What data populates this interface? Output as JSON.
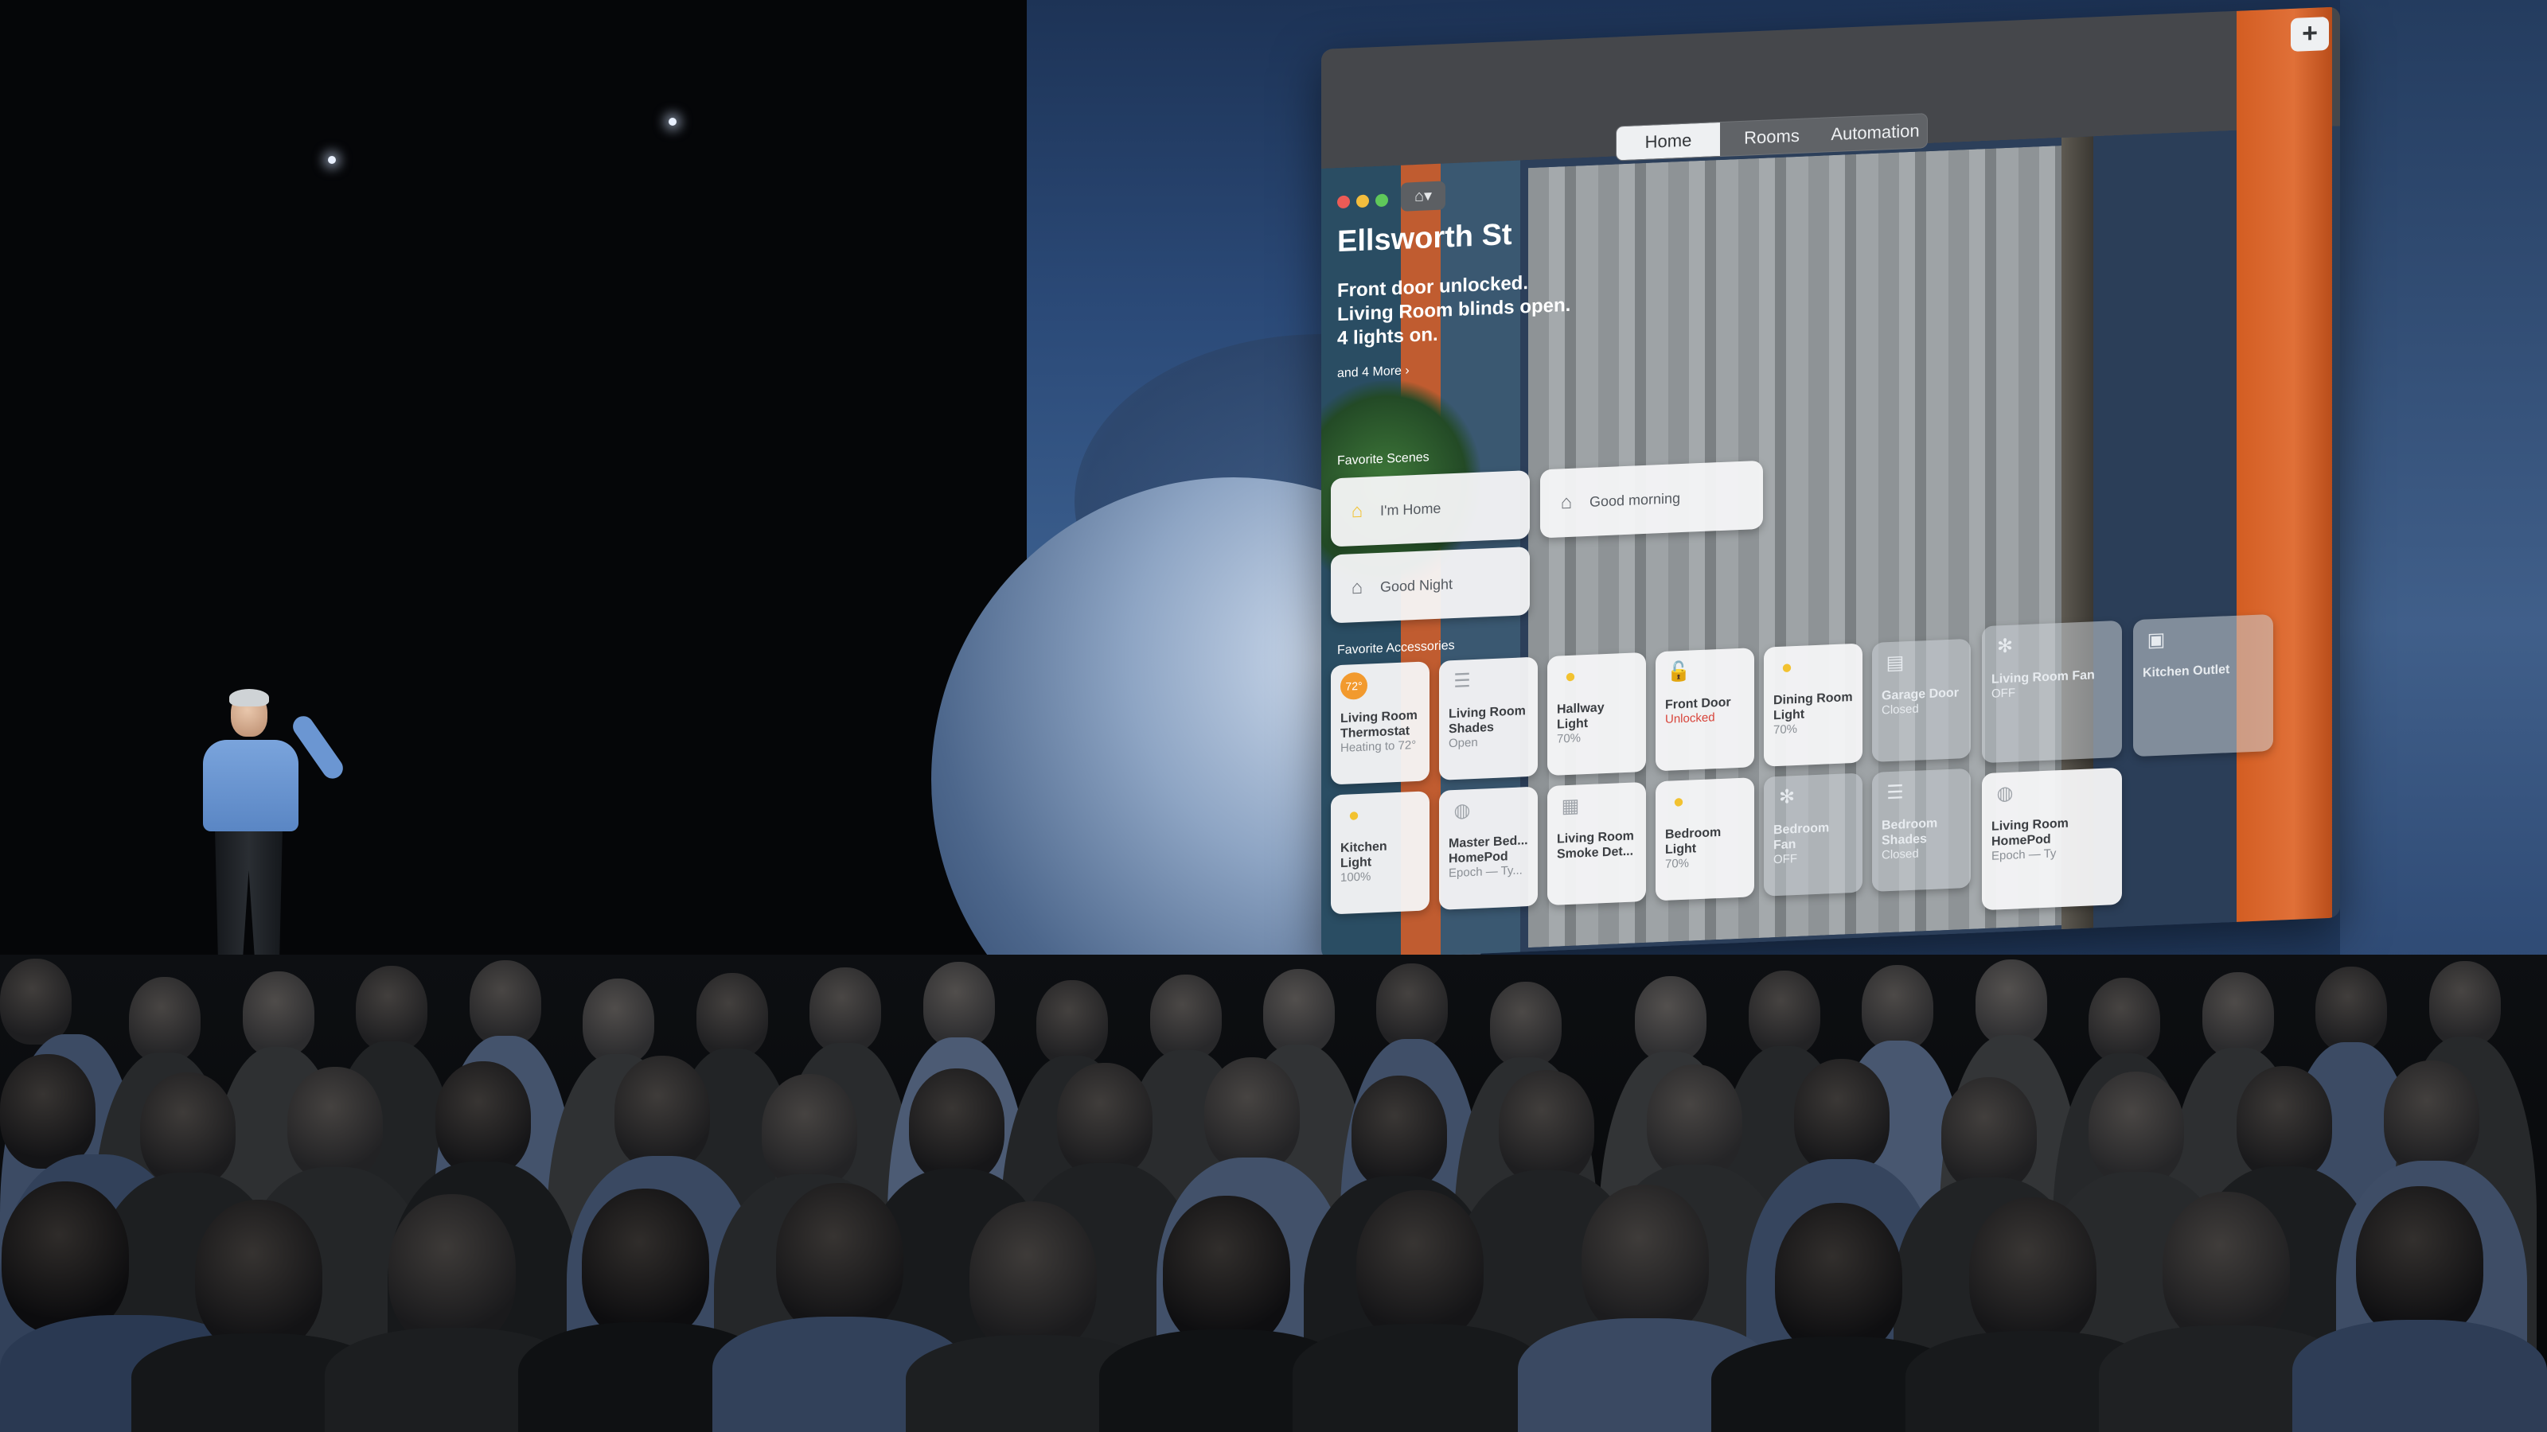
{
  "window": {
    "tabs": [
      {
        "label": "Home",
        "active": true
      },
      {
        "label": "Rooms",
        "active": false
      },
      {
        "label": "Automation",
        "active": false
      }
    ],
    "add_label": "+",
    "home_menu_icon": "house-icon"
  },
  "home": {
    "title": "Ellsworth St",
    "status_lines": [
      "Front door unlocked.",
      "Living Room blinds open.",
      "4 lights on."
    ],
    "more_link": "and 4 More ›"
  },
  "scenes": {
    "section_label": "Favorite Scenes",
    "items": [
      {
        "name": "I'm Home",
        "icon": "house-person-icon"
      },
      {
        "name": "Good morning",
        "icon": "sunrise-house-icon"
      },
      {
        "name": "Good Night",
        "icon": "moon-house-icon"
      }
    ]
  },
  "accessories": {
    "section_label": "Favorite Accessories",
    "items": [
      {
        "name": "Living Room Thermostat",
        "status": "Heating to 72°",
        "icon": "thermostat-icon",
        "on": true,
        "alert": false
      },
      {
        "name": "Living Room Shades",
        "status": "Open",
        "icon": "shades-icon",
        "on": true,
        "alert": false
      },
      {
        "name": "Hallway Light",
        "status": "70%",
        "icon": "lightbulb-icon",
        "on": true,
        "alert": false
      },
      {
        "name": "Front Door",
        "status": "Unlocked",
        "icon": "lock-open-icon",
        "on": true,
        "alert": true
      },
      {
        "name": "Dining Room Light",
        "status": "70%",
        "icon": "lightbulb-icon",
        "on": true,
        "alert": false
      },
      {
        "name": "Garage Door",
        "status": "Closed",
        "icon": "garage-icon",
        "on": false,
        "alert": false
      },
      {
        "name": "Living Room Fan",
        "status": "OFF",
        "icon": "fan-icon",
        "on": false,
        "alert": false
      },
      {
        "name": "Kitchen Outlet",
        "status": "",
        "icon": "outlet-icon",
        "on": false,
        "alert": false
      },
      {
        "name": "Kitchen Light",
        "status": "100%",
        "icon": "lightbulb-icon",
        "on": true,
        "alert": false
      },
      {
        "name": "Master Bed... HomePod",
        "status": "Epoch — Ty...",
        "icon": "homepod-icon",
        "on": true,
        "alert": false
      },
      {
        "name": "Living Room Smoke Det...",
        "status": "",
        "icon": "smoke-detector-icon",
        "on": true,
        "alert": false
      },
      {
        "name": "Bedroom Light",
        "status": "70%",
        "icon": "lightbulb-icon",
        "on": true,
        "alert": false
      },
      {
        "name": "Bedroom Fan",
        "status": "OFF",
        "icon": "fan-icon",
        "on": false,
        "alert": false
      },
      {
        "name": "Bedroom Shades",
        "status": "Closed",
        "icon": "shades-icon",
        "on": false,
        "alert": false
      },
      {
        "name": "Living Room HomePod",
        "status": "Epoch — Ty",
        "icon": "homepod-icon",
        "on": true,
        "alert": false
      }
    ]
  },
  "colors": {
    "tile_on": "#f5f6f7",
    "light_yellow": "#f2c230",
    "thermostat_orange": "#f29a2e",
    "alert_red": "#d8443a"
  }
}
